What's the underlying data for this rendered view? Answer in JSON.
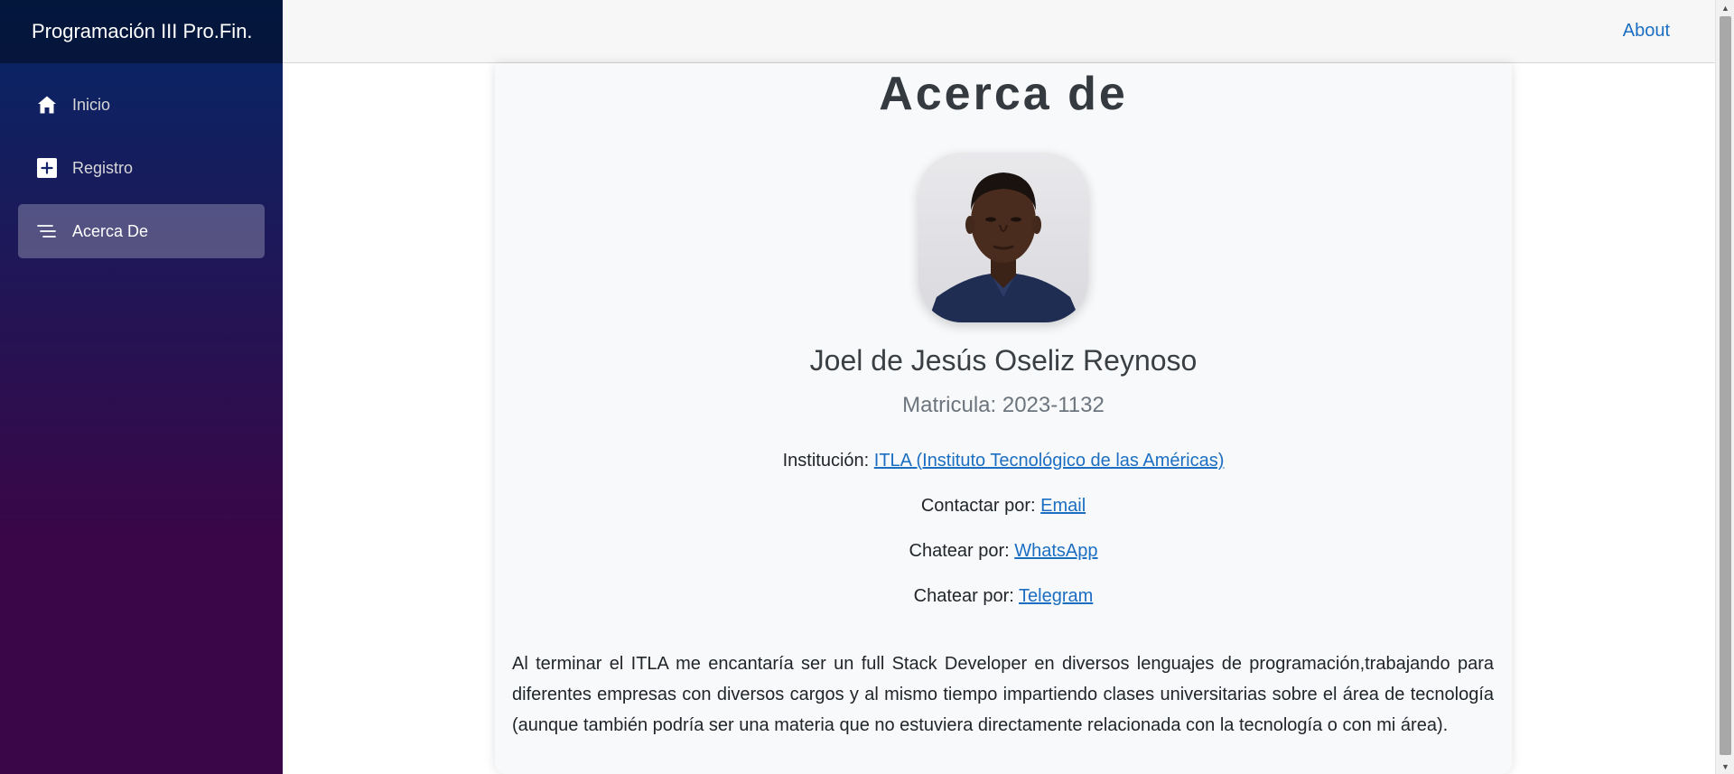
{
  "sidebar": {
    "brand": "Programación III Pro.Fin.",
    "items": [
      {
        "label": "Inicio",
        "icon": "home-icon",
        "active": false
      },
      {
        "label": "Registro",
        "icon": "plus-square-icon",
        "active": false
      },
      {
        "label": "Acerca De",
        "icon": "list-icon",
        "active": true
      }
    ]
  },
  "topbar": {
    "about_label": "About"
  },
  "profile": {
    "title": "Acerca de",
    "name": "Joel de Jesús Oseliz Reynoso",
    "matricula": "Matricula: 2023-1132",
    "institution_label": "Institución:",
    "institution_link": "ITLA (Instituto Tecnológico de las Américas)",
    "contact_label": "Contactar por:",
    "contact_link": "Email",
    "whatsapp_label": "Chatear por:",
    "whatsapp_link": "WhatsApp",
    "telegram_label": "Chatear por:",
    "telegram_link": "Telegram",
    "description": "Al terminar el ITLA me encantaría ser un full Stack Developer en diversos lenguajes de programación,trabajando para diferentes empresas con diversos cargos y al mismo tiempo impartiendo clases universitarias sobre el área de tecnología (aunque también podría ser una materia que no estuviera directamente relacionada con la tecnología o con mi área)."
  },
  "colors": {
    "sidebar_gradient_top": "#052767",
    "sidebar_gradient_bottom": "#3a0647",
    "link": "#1b6ec2",
    "card_bg": "#f8f9fa"
  }
}
